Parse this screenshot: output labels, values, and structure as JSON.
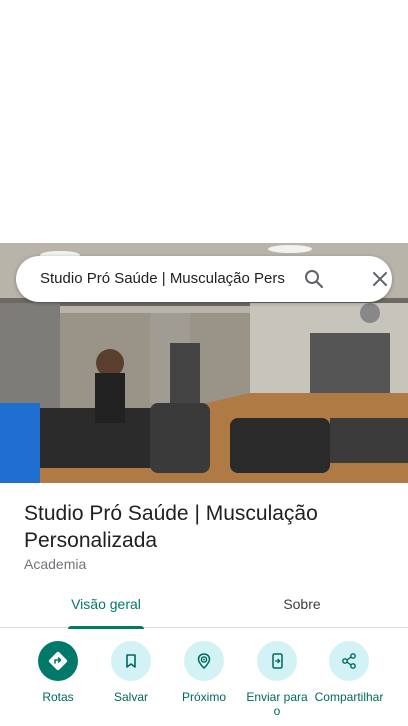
{
  "search": {
    "query": "Studio Pró Saúde | Musculação Pers"
  },
  "place": {
    "title": "Studio Pró Saúde | Musculação Personalizada",
    "category": "Academia"
  },
  "tabs": [
    {
      "label": "Visão geral",
      "active": true
    },
    {
      "label": "Sobre",
      "active": false
    }
  ],
  "actions": [
    {
      "label": "Rotas",
      "icon": "directions-icon"
    },
    {
      "label": "Salvar",
      "icon": "bookmark-icon"
    },
    {
      "label": "Próximo",
      "icon": "nearby-icon"
    },
    {
      "label": "Enviar para o",
      "icon": "send-to-phone-icon"
    },
    {
      "label": "Compartilhar",
      "icon": "share-icon"
    }
  ],
  "colors": {
    "accent": "#00796b",
    "action_bg": "#d2f2f5",
    "text": "#202124",
    "muted": "#70757a"
  }
}
